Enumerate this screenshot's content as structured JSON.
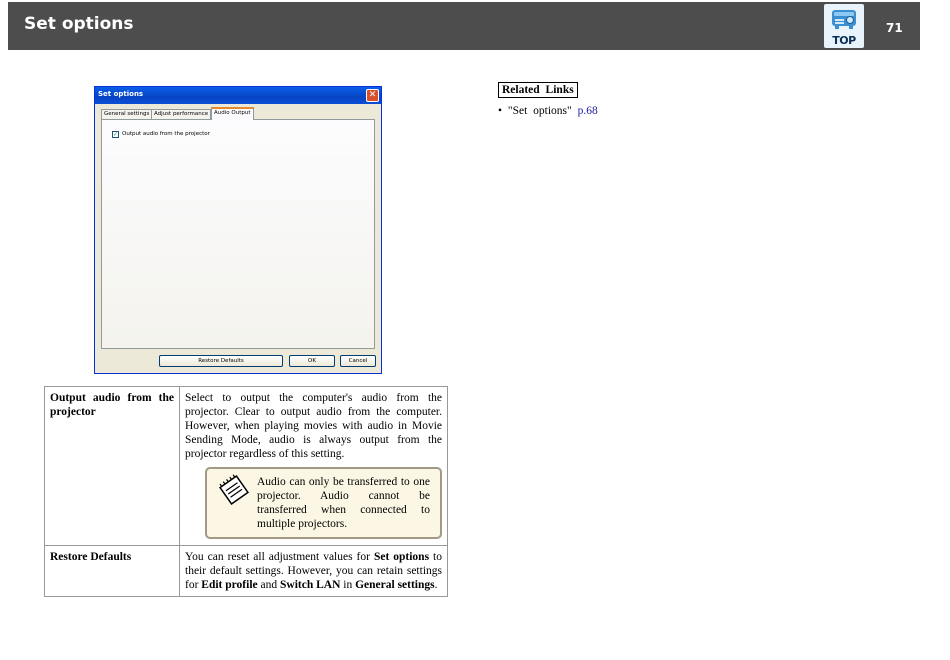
{
  "header": {
    "title": "Set options",
    "top_label": "TOP",
    "page_number": "71"
  },
  "dialog": {
    "title": "Set options",
    "close_glyph": "✕",
    "tabs": [
      "General settings",
      "Adjust performance",
      "Audio Output"
    ],
    "active_tab": "Audio Output",
    "checkbox_label": "Output audio from the projector",
    "checkbox_checked": true,
    "buttons": {
      "restore": "Restore Defaults",
      "ok": "OK",
      "cancel": "Cancel"
    }
  },
  "table": {
    "rows": [
      {
        "term": "Output audio from the projector",
        "description": "Select to output the computer's audio from the projector. Clear to output audio from the computer. However, when playing movies with audio in Movie Sending Mode, audio is always output from the projector regardless of this setting.",
        "note": "Audio can only be transferred to one projector. Audio cannot be transferred when connected to multiple projectors."
      },
      {
        "term": "Restore Defaults",
        "desc_parts": [
          "You can reset all adjustment values for ",
          "Set options",
          " to their default settings. However, you can retain settings for ",
          "Edit profile",
          " and ",
          "Switch LAN",
          " in ",
          "General settings",
          "."
        ]
      }
    ]
  },
  "related": {
    "heading": "Related Links",
    "bullet": "•",
    "item_text": "\"Set options\"",
    "item_link": "p.68"
  },
  "icons": {
    "top_button": "projector-top-icon",
    "note": "note-pad-icon"
  },
  "colors": {
    "header_bg": "#4d4d4d",
    "link": "#1a1aa6",
    "note_bg": "#fbf7e4",
    "dialog_titlebar": "#0a5ee8"
  }
}
